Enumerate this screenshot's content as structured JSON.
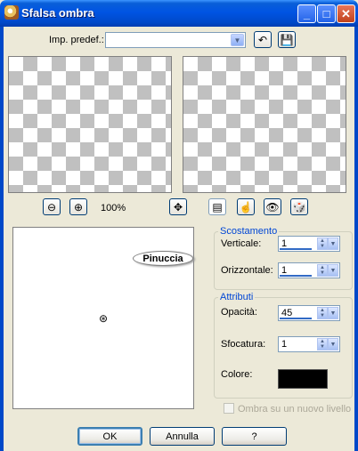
{
  "window": {
    "title": "Sfalsa ombra"
  },
  "presets": {
    "label": "Imp. predef.:",
    "value": ""
  },
  "zoom": {
    "level": "100%"
  },
  "preview": {
    "badge_text": "Pinuccia"
  },
  "offset": {
    "legend": "Scostamento",
    "vertical": {
      "label": "Verticale:",
      "value": "1"
    },
    "horizontal": {
      "label": "Orizzontale:",
      "value": "1"
    }
  },
  "attributes": {
    "legend": "Attributi",
    "opacity": {
      "label": "Opacità:",
      "value": "45"
    },
    "blur": {
      "label": "Sfocatura:",
      "value": "1"
    },
    "color": {
      "label": "Colore:",
      "value": "#000000"
    }
  },
  "new_layer_checkbox": {
    "label": "Ombra su un nuovo livello",
    "checked": false
  },
  "buttons": {
    "ok": "OK",
    "cancel": "Annulla",
    "help": "?"
  }
}
